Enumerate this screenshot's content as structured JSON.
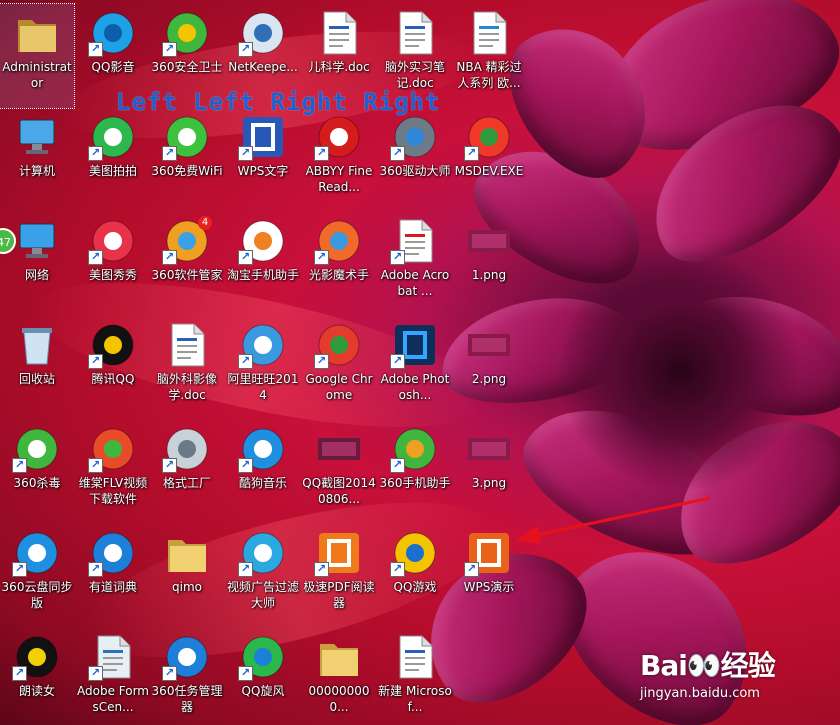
{
  "overlay_caption": "Left Left Right Right",
  "watermark": {
    "logo": "Bai👀经验",
    "url": "jingyan.baidu.com"
  },
  "side_badge": "47",
  "colors": {
    "accent_caption": "#1f5fd0",
    "arrow": "#e8101a"
  },
  "icons": [
    {
      "col": 0,
      "row": 0,
      "label": "Administrator",
      "icon": "user-folder-icon",
      "shortcut": false,
      "selected": true
    },
    {
      "col": 1,
      "row": 0,
      "label": "QQ影音",
      "icon": "qq-player-icon",
      "shortcut": true
    },
    {
      "col": 2,
      "row": 0,
      "label": "360安全卫士",
      "icon": "360-security-icon",
      "shortcut": true
    },
    {
      "col": 3,
      "row": 0,
      "label": "NetKeepe...",
      "icon": "netkeeper-icon",
      "shortcut": true
    },
    {
      "col": 4,
      "row": 0,
      "label": "儿科学.doc",
      "icon": "doc-file-icon",
      "shortcut": false
    },
    {
      "col": 5,
      "row": 0,
      "label": "脑外实习笔记.doc",
      "icon": "doc-file-icon",
      "shortcut": false
    },
    {
      "col": 6,
      "row": 0,
      "label": "NBA 精彩过人系列 欧...",
      "icon": "flv-file-icon",
      "shortcut": false
    },
    {
      "col": 0,
      "row": 1,
      "label": "计算机",
      "icon": "computer-icon",
      "shortcut": false
    },
    {
      "col": 1,
      "row": 1,
      "label": "美图拍拍",
      "icon": "meitu-paipai-icon",
      "shortcut": true
    },
    {
      "col": 2,
      "row": 1,
      "label": "360免费WiFi",
      "icon": "wifi-icon",
      "shortcut": true
    },
    {
      "col": 3,
      "row": 1,
      "label": "WPS文字",
      "icon": "wps-writer-icon",
      "shortcut": true
    },
    {
      "col": 4,
      "row": 1,
      "label": "ABBYY FineRead...",
      "icon": "abbyy-icon",
      "shortcut": true
    },
    {
      "col": 5,
      "row": 1,
      "label": "360驱动大师",
      "icon": "driver-master-icon",
      "shortcut": true
    },
    {
      "col": 6,
      "row": 1,
      "label": "MSDEV.EXE",
      "icon": "msdev-icon",
      "shortcut": true
    },
    {
      "col": 0,
      "row": 2,
      "label": "网络",
      "icon": "network-icon",
      "shortcut": false
    },
    {
      "col": 1,
      "row": 2,
      "label": "美图秀秀",
      "icon": "meitu-xiuxiu-icon",
      "shortcut": true
    },
    {
      "col": 2,
      "row": 2,
      "label": "360软件管家",
      "icon": "software-manager-icon",
      "shortcut": true,
      "badge": "4"
    },
    {
      "col": 3,
      "row": 2,
      "label": "淘宝手机助手",
      "icon": "taobao-assistant-icon",
      "shortcut": true
    },
    {
      "col": 4,
      "row": 2,
      "label": "光影魔术手",
      "icon": "nEO-imaging-icon",
      "shortcut": true
    },
    {
      "col": 5,
      "row": 2,
      "label": "Adobe Acrobat ...",
      "icon": "acrobat-icon",
      "shortcut": true
    },
    {
      "col": 6,
      "row": 2,
      "label": "1.png",
      "icon": "png-thumb-icon",
      "shortcut": false
    },
    {
      "col": 0,
      "row": 3,
      "label": "回收站",
      "icon": "recycle-bin-icon",
      "shortcut": false
    },
    {
      "col": 1,
      "row": 3,
      "label": "腾讯QQ",
      "icon": "qq-penguin-icon",
      "shortcut": true
    },
    {
      "col": 2,
      "row": 3,
      "label": "脑外科影像学.doc",
      "icon": "doc-file-icon",
      "shortcut": false
    },
    {
      "col": 3,
      "row": 3,
      "label": "阿里旺旺2014",
      "icon": "aliwangwang-icon",
      "shortcut": true
    },
    {
      "col": 4,
      "row": 3,
      "label": "Google Chrome",
      "icon": "chrome-icon",
      "shortcut": true
    },
    {
      "col": 5,
      "row": 3,
      "label": "Adobe Photosh...",
      "icon": "photoshop-icon",
      "shortcut": true
    },
    {
      "col": 6,
      "row": 3,
      "label": "2.png",
      "icon": "png-thumb-icon",
      "shortcut": false
    },
    {
      "col": 0,
      "row": 4,
      "label": "360杀毒",
      "icon": "360-antivirus-icon",
      "shortcut": true
    },
    {
      "col": 1,
      "row": 4,
      "label": "维棠FLV视频下载软件",
      "icon": "weitang-icon",
      "shortcut": true
    },
    {
      "col": 2,
      "row": 4,
      "label": "格式工厂",
      "icon": "format-factory-icon",
      "shortcut": true
    },
    {
      "col": 3,
      "row": 4,
      "label": "酷狗音乐",
      "icon": "kugou-icon",
      "shortcut": true
    },
    {
      "col": 4,
      "row": 4,
      "label": "QQ截图20140806...",
      "icon": "screenshot-thumb-icon",
      "shortcut": false
    },
    {
      "col": 5,
      "row": 4,
      "label": "360手机助手",
      "icon": "360-phone-assistant-icon",
      "shortcut": true
    },
    {
      "col": 6,
      "row": 4,
      "label": "3.png",
      "icon": "png-thumb-icon",
      "shortcut": false
    },
    {
      "col": 0,
      "row": 5,
      "label": "360云盘同步版",
      "icon": "360-cloud-icon",
      "shortcut": true
    },
    {
      "col": 1,
      "row": 5,
      "label": "有道词典",
      "icon": "youdao-icon",
      "shortcut": true
    },
    {
      "col": 2,
      "row": 5,
      "label": "qimo",
      "icon": "folder-icon",
      "shortcut": false
    },
    {
      "col": 3,
      "row": 5,
      "label": "视频广告过滤大师",
      "icon": "ad-filter-icon",
      "shortcut": true
    },
    {
      "col": 4,
      "row": 5,
      "label": "极速PDF阅读器",
      "icon": "pdf-reader-icon",
      "shortcut": true
    },
    {
      "col": 5,
      "row": 5,
      "label": "QQ游戏",
      "icon": "qq-game-icon",
      "shortcut": true
    },
    {
      "col": 6,
      "row": 5,
      "label": "WPS演示",
      "icon": "wps-presentation-icon",
      "shortcut": true
    },
    {
      "col": 0,
      "row": 6,
      "label": "朗读女",
      "icon": "reader-girl-icon",
      "shortcut": true
    },
    {
      "col": 1,
      "row": 6,
      "label": "Adobe FormsCen...",
      "icon": "forms-central-icon",
      "shortcut": true
    },
    {
      "col": 2,
      "row": 6,
      "label": "360任务管理器",
      "icon": "task-manager-icon",
      "shortcut": true
    },
    {
      "col": 3,
      "row": 6,
      "label": "QQ旋风",
      "icon": "qq-xuanfeng-icon",
      "shortcut": true
    },
    {
      "col": 4,
      "row": 6,
      "label": "000000000...",
      "icon": "folder-icon",
      "shortcut": false
    },
    {
      "col": 5,
      "row": 6,
      "label": "新建 Microsof...",
      "icon": "doc-file-icon",
      "shortcut": false
    }
  ]
}
